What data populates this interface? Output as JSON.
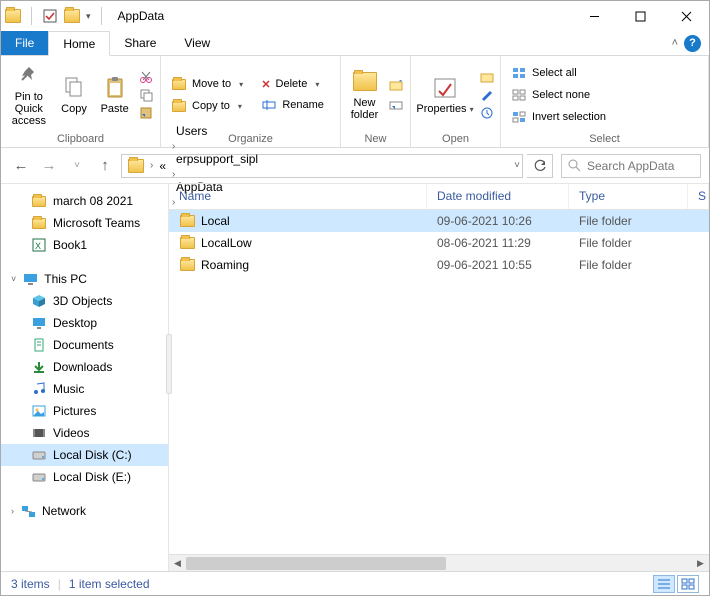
{
  "title": "AppData",
  "tabs": {
    "file": "File",
    "home": "Home",
    "share": "Share",
    "view": "View"
  },
  "ribbon": {
    "clipboard": {
      "pin": "Pin to Quick access",
      "copy": "Copy",
      "paste": "Paste",
      "label": "Clipboard"
    },
    "organize": {
      "move": "Move to",
      "copy": "Copy to",
      "delete": "Delete",
      "rename": "Rename",
      "label": "Organize"
    },
    "new": {
      "newfolder": "New folder",
      "label": "New"
    },
    "open": {
      "properties": "Properties",
      "label": "Open"
    },
    "select": {
      "all": "Select all",
      "none": "Select none",
      "invert": "Invert selection",
      "label": "Select"
    }
  },
  "breadcrumb": {
    "items": [
      "Users",
      "erpsupport_sipl",
      "AppData"
    ],
    "prefix": "«"
  },
  "search": {
    "placeholder": "Search AppData"
  },
  "sidebar": {
    "quick": [
      {
        "label": "march 08 2021",
        "kind": "folder"
      },
      {
        "label": "Microsoft Teams",
        "kind": "folder"
      },
      {
        "label": "Book1",
        "kind": "excel"
      }
    ],
    "thispc": "This PC",
    "pc": [
      {
        "label": "3D Objects",
        "glyph": "cube"
      },
      {
        "label": "Desktop",
        "glyph": "desktop"
      },
      {
        "label": "Documents",
        "glyph": "doc"
      },
      {
        "label": "Downloads",
        "glyph": "down"
      },
      {
        "label": "Music",
        "glyph": "music"
      },
      {
        "label": "Pictures",
        "glyph": "pic"
      },
      {
        "label": "Videos",
        "glyph": "vid"
      },
      {
        "label": "Local Disk (C:)",
        "glyph": "disk",
        "selected": true
      },
      {
        "label": "Local Disk (E:)",
        "glyph": "disk"
      }
    ],
    "network": "Network"
  },
  "columns": {
    "name": "Name",
    "date": "Date modified",
    "type": "Type",
    "size": "S"
  },
  "rows": [
    {
      "name": "Local",
      "date": "09-06-2021 10:26",
      "type": "File folder",
      "selected": true
    },
    {
      "name": "LocalLow",
      "date": "08-06-2021 11:29",
      "type": "File folder"
    },
    {
      "name": "Roaming",
      "date": "09-06-2021 10:55",
      "type": "File folder"
    }
  ],
  "status": {
    "count": "3 items",
    "sel": "1 item selected"
  }
}
